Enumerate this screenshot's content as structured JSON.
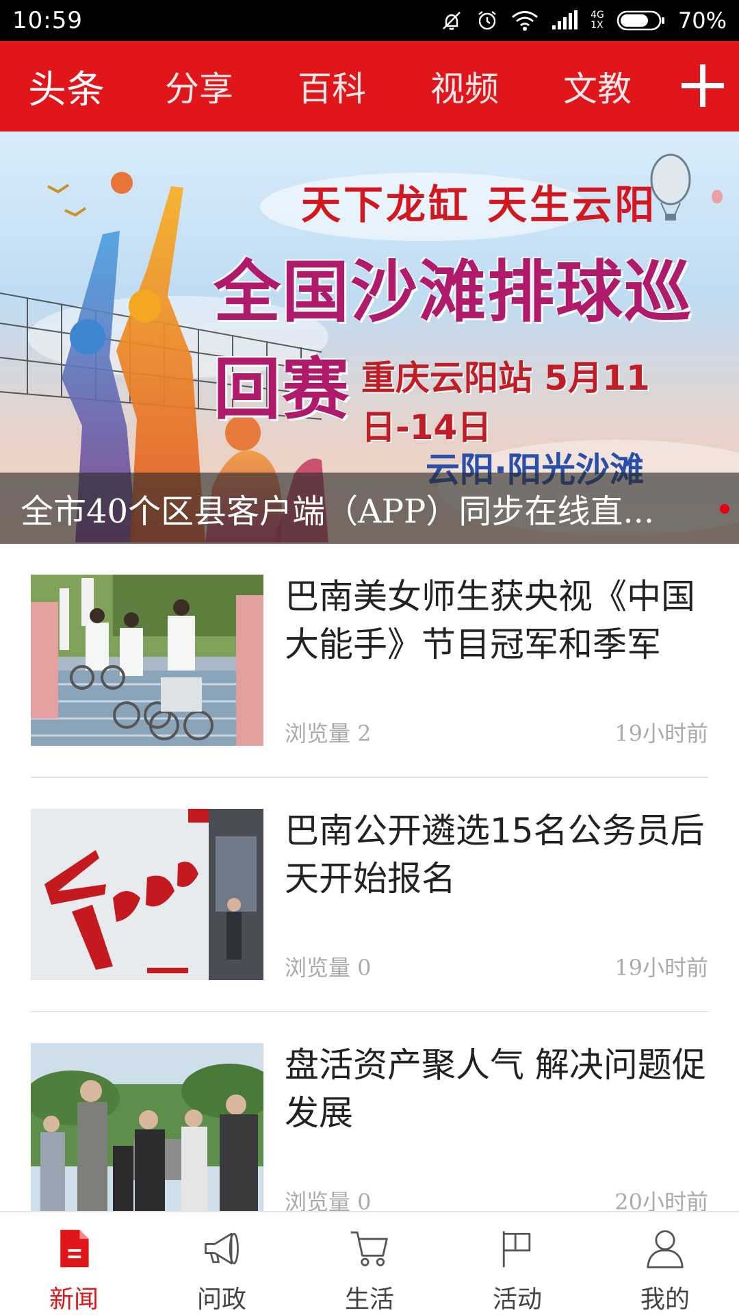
{
  "status_bar": {
    "time": "10:59",
    "network_top": "4G",
    "network_bottom": "1X",
    "battery": "70%"
  },
  "channels": {
    "tabs": [
      "头条",
      "分享",
      "百科",
      "视频",
      "文教"
    ],
    "active_index": 0,
    "add_icon": "plus-icon"
  },
  "banner": {
    "slogan": "天下龙缸 天生云阳",
    "headline": "全国沙滩排球巡回赛",
    "dates": "重庆云阳站 5月11日-14日",
    "venue": "云阳·阳光沙滩",
    "caption": "全市40个区县客户端（APP）同步在线直..."
  },
  "news": [
    {
      "title": "巴南美女师生获央视《中国大能手》节目冠军和季军",
      "views": "浏览量 2",
      "time": "19小时前"
    },
    {
      "title": "巴南公开遴选15名公务员后天开始报名",
      "views": "浏览量 0",
      "time": "19小时前"
    },
    {
      "title": "盘活资产聚人气 解决问题促发展",
      "views": "浏览量 0",
      "time": "20小时前"
    }
  ],
  "nav": {
    "items": [
      {
        "label": "新闻",
        "icon": "document-icon"
      },
      {
        "label": "问政",
        "icon": "megaphone-icon"
      },
      {
        "label": "生活",
        "icon": "cart-icon"
      },
      {
        "label": "活动",
        "icon": "flag-icon"
      },
      {
        "label": "我的",
        "icon": "person-icon"
      }
    ],
    "active_index": 0
  },
  "colors": {
    "brand_red": "#e0161b",
    "status_bar": "#000000",
    "meta_gray": "#aaaaaa"
  }
}
